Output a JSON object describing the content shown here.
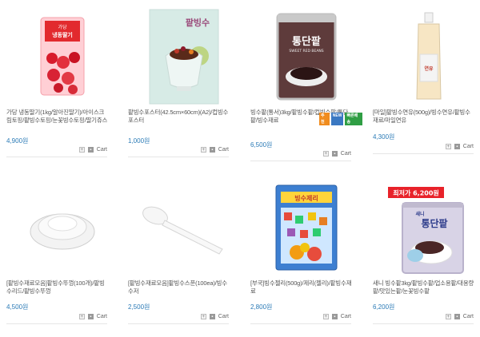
{
  "products": [
    {
      "name": "가당 냉동딸기(1kg/알아진딸기)/아이스크림토핑/팥빙수토핑/눈꽃빙수토핑/딸기쥬스",
      "price": "4,900원",
      "cart": "Cart"
    },
    {
      "name": "팥빙수포스터(42.5cm×60cm)(A2)/컵빙수포스터",
      "price": "1,000원",
      "cart": "Cart"
    },
    {
      "name": "빙수팥(통서)3kg/팥빙수팥/컵빙수팥/통단팥/빙수재료",
      "price": "6,500원",
      "cart": "Cart",
      "badges": [
        "추천",
        "NEW",
        "빠른배송"
      ]
    },
    {
      "name": "[마일]팥빙수연유(500g)/빙수연유/팥빙수재료/마일연유",
      "price": "4,300원",
      "cart": "Cart"
    },
    {
      "name": "[팥빙수재료모음]팥빙수뚜껑(100개)/팥빙수리드/팥빙수뚜껑",
      "price": "4,500원",
      "cart": "Cart"
    },
    {
      "name": "[팥빙수재료모음]팥빙수스푼(100ea)/빙수수저",
      "price": "2,500원",
      "cart": "Cart"
    },
    {
      "name": "[부국]빙수젤리(500g)/제리(젤리)/팥빙수재료",
      "price": "2,800원",
      "cart": "Cart"
    },
    {
      "name": "새니 빙수팥3kg/팥빙수팥/업소용팥/대용량팥/맛있는팥/눈꽃빙수팥",
      "price": "6,200원",
      "cart": "Cart"
    }
  ],
  "images": {
    "p1_label": "냉동딸기",
    "p1_brand": "가당",
    "p2_title": "팥빙수",
    "p3_title": "통단팥",
    "p3_sub": "SWEET RED BEANS",
    "p4_label": "연유",
    "p6_label": "",
    "p7_title": "빙수제리",
    "p8_banner": "최저가 6,200원",
    "p8_brand": "새니",
    "p8_title": "통단팥"
  },
  "colors": {
    "price": "#2a7ab6",
    "text": "#555555",
    "banner": "#e8222a"
  }
}
